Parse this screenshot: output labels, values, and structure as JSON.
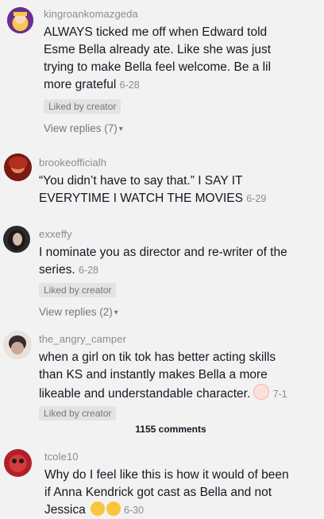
{
  "comments": [
    {
      "username": "kingroankomazgeda",
      "text": "ALWAYS ticked me off when Edward told\nEsme Bella already ate. Like she was just\ntrying to make Bella feel welcome. Be a lil\nmore grateful",
      "date": "6-28",
      "liked": "Liked by creator",
      "replies": "View replies (7)"
    },
    {
      "username": "brookeofficialh",
      "text": "“You didn’t have to say that.” I SAY IT\nEVERYTIME I WATCH THE MOVIES",
      "date": "6-29"
    },
    {
      "username": "exxeffy",
      "text": "I nominate you as director and re-writer of the\nseries.",
      "date": "6-28",
      "liked": "Liked by creator",
      "replies": "View replies (2)"
    },
    {
      "username": "the_angry_camper",
      "text": "when a girl on tik tok has better acting skills\nthan KS and instantly makes Bella a more\nlikeable and understandable character.",
      "date": "7-1",
      "liked": "Liked by creator"
    },
    {
      "username": "tcole10",
      "text": "Why do I feel like this is how it would of been\nif Anna Kendrick got cast as Bella and not\nJessica",
      "date": "6-30"
    }
  ],
  "comment_count": "1155 comments",
  "icons": {
    "chevron": "chevron-down-icon",
    "emoji_blush": "blush-emoji-icon",
    "emoji_laugh": "rofl-emoji-icon"
  }
}
